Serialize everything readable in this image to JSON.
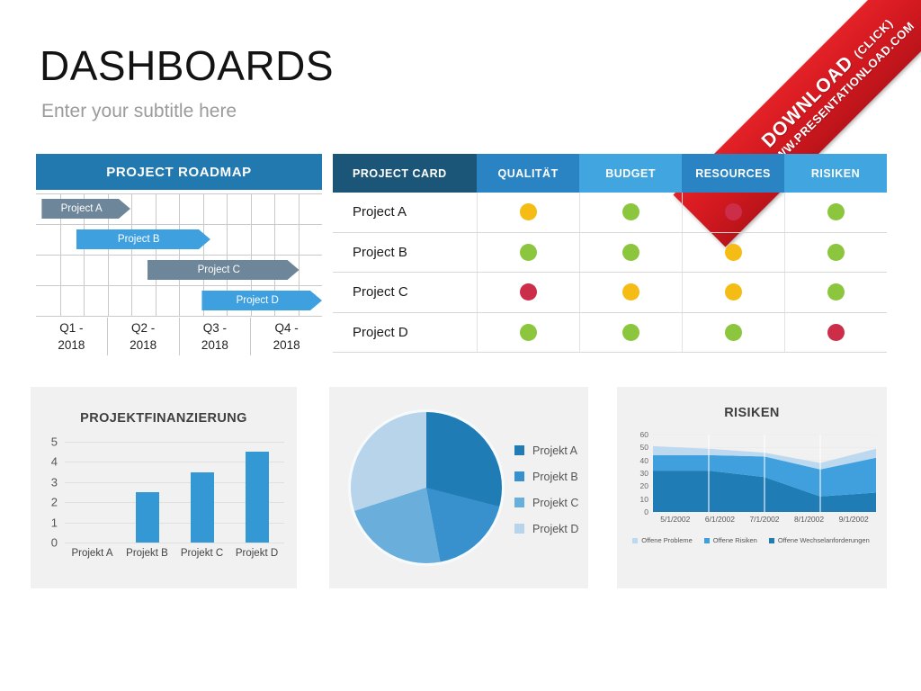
{
  "header": {
    "title": "DASHBOARDS",
    "subtitle": "Enter your subtitle here"
  },
  "ribbon": {
    "line1": "DOWNLOAD",
    "line1_suffix": "(CLICK)",
    "line2": "WWW.PRESENTATIONLOAD.COM",
    "color": "#d41920"
  },
  "roadmap": {
    "title": "PROJECT ROADMAP",
    "header_color": "#2179b0",
    "quarters": [
      "Q1 -\n2018",
      "Q2 -\n2018",
      "Q3 -\n2018",
      "Q4 -\n2018"
    ],
    "quarter_labels": [
      {
        "line1": "Q1 -",
        "line2": "2018"
      },
      {
        "line1": "Q2 -",
        "line2": "2018"
      },
      {
        "line1": "Q3 -",
        "line2": "2018"
      },
      {
        "line1": "Q4 -",
        "line2": "2018"
      }
    ],
    "bars": [
      {
        "label": "Project A",
        "start_pct": 2,
        "width_pct": 31,
        "row": 0,
        "color": "#6d8699"
      },
      {
        "label": "Project B",
        "start_pct": 14,
        "width_pct": 47,
        "row": 1,
        "color": "#3fa0e0"
      },
      {
        "label": "Project C",
        "start_pct": 39,
        "width_pct": 53,
        "row": 2,
        "color": "#6d8699"
      },
      {
        "label": "Project D",
        "start_pct": 58,
        "width_pct": 42,
        "row": 3,
        "color": "#3fa0e0"
      }
    ]
  },
  "project_card": {
    "columns": [
      {
        "label": "PROJECT CARD",
        "color": "#1b5679",
        "width": 26
      },
      {
        "label": "QUALITÄT",
        "color": "#2a84c3",
        "width": 18.5
      },
      {
        "label": "BUDGET",
        "color": "#41a5e0",
        "width": 18.5
      },
      {
        "label": "RESOURCES",
        "color": "#2a84c3",
        "width": 18.5
      },
      {
        "label": "RISIKEN",
        "color": "#41a5e0",
        "width": 18.5
      }
    ],
    "status_colors": {
      "green": "#8cc63e",
      "amber": "#f5bc15",
      "red": "#cc2e4a"
    },
    "rows": [
      {
        "name": "Project A",
        "statuses": [
          "amber",
          "green",
          "red",
          "green"
        ]
      },
      {
        "name": "Project B",
        "statuses": [
          "green",
          "green",
          "amber",
          "green"
        ]
      },
      {
        "name": "Project C",
        "statuses": [
          "red",
          "amber",
          "amber",
          "green"
        ]
      },
      {
        "name": "Project D",
        "statuses": [
          "green",
          "green",
          "green",
          "red"
        ]
      }
    ]
  },
  "chart_data": [
    {
      "type": "bar",
      "title": "PROJEKTFINANZIERUNG",
      "categories": [
        "Projekt A",
        "Projekt B",
        "Projekt C",
        "Projekt D"
      ],
      "values": [
        0,
        2.5,
        3.5,
        4.5
      ],
      "ylim": [
        0,
        5
      ],
      "yticks": [
        5,
        4,
        3,
        2,
        1,
        0
      ],
      "xlabel": "",
      "ylabel": "",
      "grid": true,
      "bar_color": "#3498d4"
    },
    {
      "type": "pie",
      "title": "",
      "labels": [
        "Projekt A",
        "Projekt B",
        "Projekt C",
        "Projekt D"
      ],
      "values": [
        29,
        18,
        23,
        30
      ],
      "colors": [
        "#1f7cb4",
        "#3890cc",
        "#6aaedb",
        "#b8d4ea"
      ],
      "legend_position": "right"
    },
    {
      "type": "area",
      "title": "RISIKEN",
      "x": [
        "5/1/2002",
        "6/1/2002",
        "7/1/2002",
        "8/1/2002",
        "9/1/2002"
      ],
      "ylim": [
        0,
        60
      ],
      "yticks": [
        60,
        50,
        40,
        30,
        20,
        10,
        0
      ],
      "stacked": true,
      "series": [
        {
          "name": "Offene Wechselanforderungen",
          "values": [
            32,
            32,
            27,
            12,
            15
          ],
          "color": "#1f7cb4"
        },
        {
          "name": "Offene Risiken",
          "values": [
            12,
            12,
            16,
            21,
            27
          ],
          "color": "#3fa0dd"
        },
        {
          "name": "Offene Probleme",
          "values": [
            7,
            5,
            3,
            5,
            7
          ],
          "color": "#bcd9ef"
        }
      ],
      "legend_position": "bottom",
      "legend_order": [
        "Offene Probleme",
        "Offene Risiken",
        "Offene Wechselanforderungen"
      ],
      "grid": true
    }
  ]
}
